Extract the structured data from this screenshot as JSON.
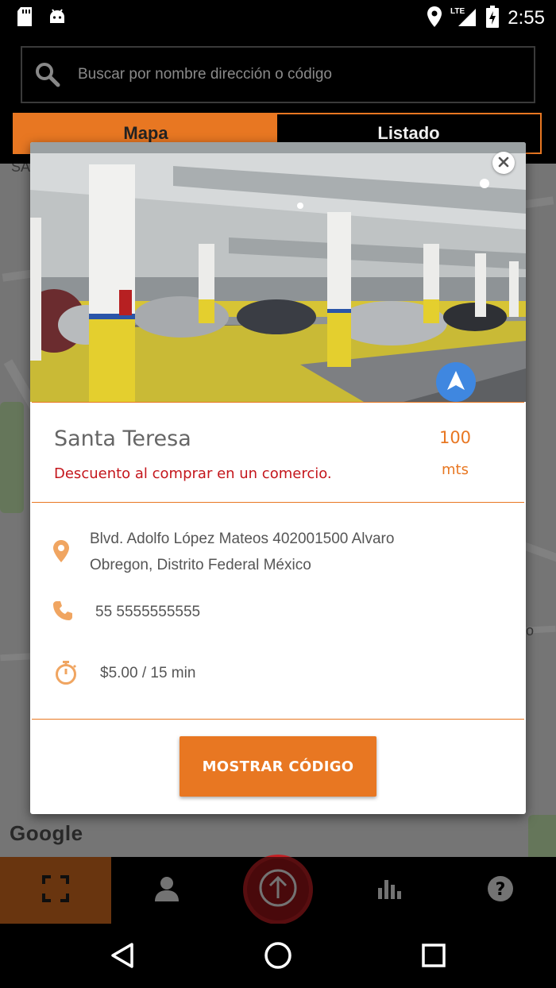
{
  "status_bar": {
    "time": "2:55",
    "network": "LTE",
    "icons": [
      "sd-card-icon",
      "android-icon",
      "location-icon",
      "signal-icon",
      "battery-charging-icon"
    ]
  },
  "search": {
    "placeholder": "Buscar por nombre dirección o código",
    "icon": "search-icon"
  },
  "tabs": [
    {
      "label": "Mapa",
      "active": true
    },
    {
      "label": "Listado",
      "active": false
    }
  ],
  "map": {
    "attribution": "Google"
  },
  "detail_card": {
    "name": "Santa Teresa",
    "promo": "Descuento al comprar en un comercio.",
    "distance_value": "100",
    "distance_unit": "mts",
    "address": "Blvd. Adolfo López Mateos 402001500 Alvaro Obregon, Distrito Federal México",
    "phone": "55 5555555555",
    "rate": "$5.00 / 15 min",
    "cta_label": "MOSTRAR CÓDIGO",
    "close_icon": "close-icon",
    "navigate_icon": "navigation-arrow-icon"
  },
  "bottom_nav": {
    "items": [
      "scan-icon",
      "user-icon",
      "upload-icon",
      "stats-icon",
      "help-icon"
    ],
    "active": "scan-icon"
  },
  "system_nav": [
    "back-icon",
    "home-icon",
    "recents-icon"
  ],
  "colors": {
    "accent": "#e87722",
    "promo_red": "#c4161c",
    "fab_blue": "#3f87e0",
    "upload_red": "#a3141a"
  }
}
